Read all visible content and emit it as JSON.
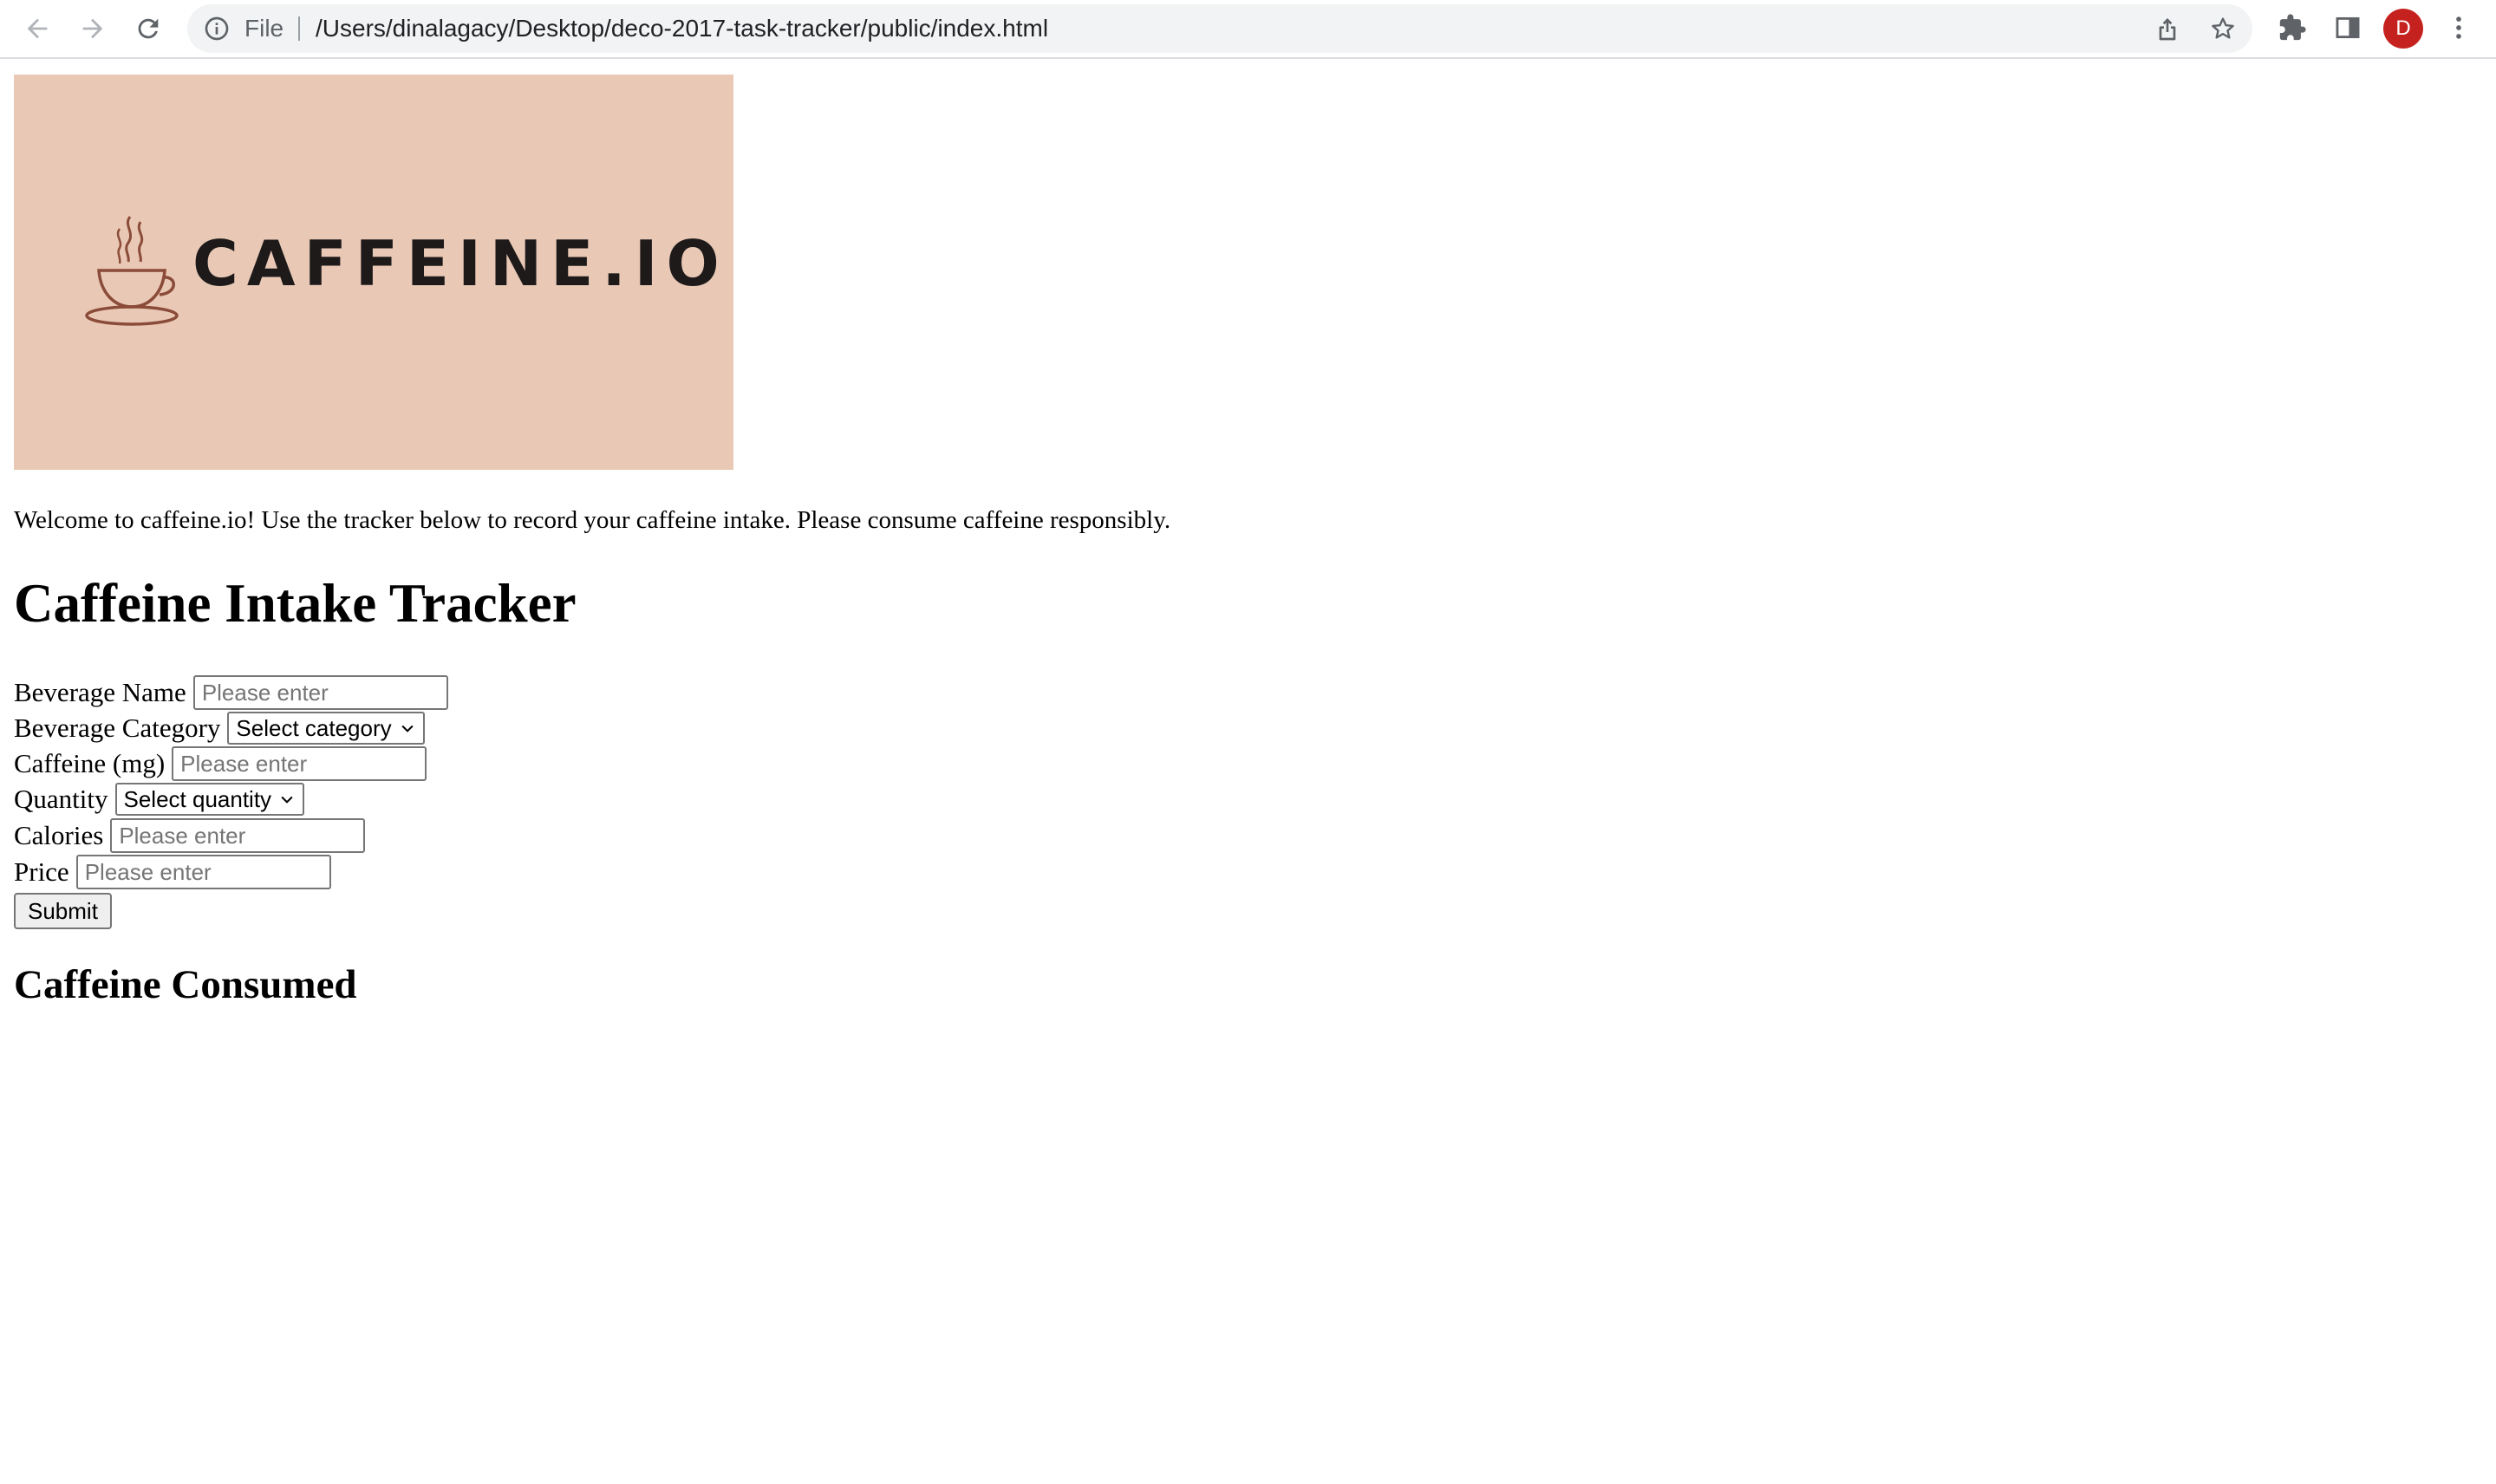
{
  "browser": {
    "scheme_label": "File",
    "url": "/Users/dinalagacy/Desktop/deco-2017-task-tracker/public/index.html",
    "profile_initial": "D",
    "profile_color": "#c5221f"
  },
  "banner": {
    "logo_text": "CAFFEINE.IO",
    "background_color": "#e9c9b6"
  },
  "welcome_text": "Welcome to caffeine.io! Use the tracker below to record your caffeine intake. Please consume caffeine responsibly.",
  "title": "Caffeine Intake Tracker",
  "form": {
    "beverage_name": {
      "label": "Beverage Name",
      "placeholder": "Please enter"
    },
    "beverage_category": {
      "label": "Beverage Category",
      "selected": "Select category"
    },
    "caffeine": {
      "label": "Caffeine (mg)",
      "placeholder": "Please enter"
    },
    "quantity": {
      "label": "Quantity",
      "selected": "Select quantity"
    },
    "calories": {
      "label": "Calories",
      "placeholder": "Please enter"
    },
    "price": {
      "label": "Price",
      "placeholder": "Please enter"
    },
    "submit_label": "Submit"
  },
  "consumed_title": "Caffeine Consumed"
}
